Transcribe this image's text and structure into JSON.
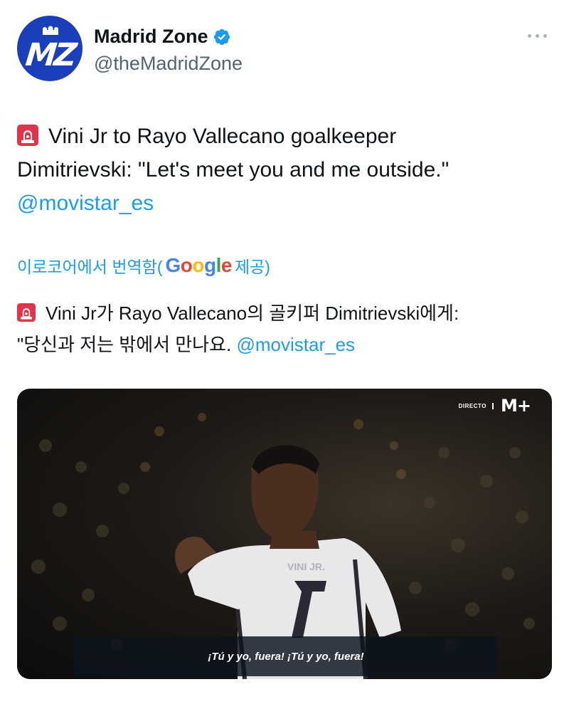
{
  "account": {
    "display_name": "Madrid Zone",
    "handle": "@theMadridZone",
    "avatar_text": "MZ",
    "verified": true
  },
  "tweet": {
    "text_line1": "Vini Jr to Rayo Vallecano goalkeeper",
    "text_line2": "Dimitrievski: \"Let's meet you and me outside.\"",
    "mention": "@movistar_es"
  },
  "translation": {
    "label_prefix": "이로코어에서 번역함(",
    "google_G": "G",
    "google_o1": "o",
    "google_o2": "o",
    "google_g": "g",
    "google_l": "l",
    "google_e": "e",
    "label_suffix": " 제공)",
    "text_line1": "Vini Jr가 Rayo Vallecano의 골키퍼 Dimitrievski에게:",
    "text_line2": "\"당신과 저는 밖에서 만나요.",
    "mention": "@movistar_es"
  },
  "media": {
    "broadcast_label": "DIRECTO",
    "channel_logo": "M+",
    "subtitle": "¡Tú y yo, fuera! ¡Tú y yo, fuera!",
    "jersey_number": "7"
  },
  "icons": {
    "siren": "rotating-light-icon",
    "verified": "verified-badge-icon",
    "more": "more-options-icon"
  },
  "colors": {
    "accent": "#1d9bf0",
    "verified": "#1d9bf0",
    "avatar_bg": "#1a3fb8"
  }
}
